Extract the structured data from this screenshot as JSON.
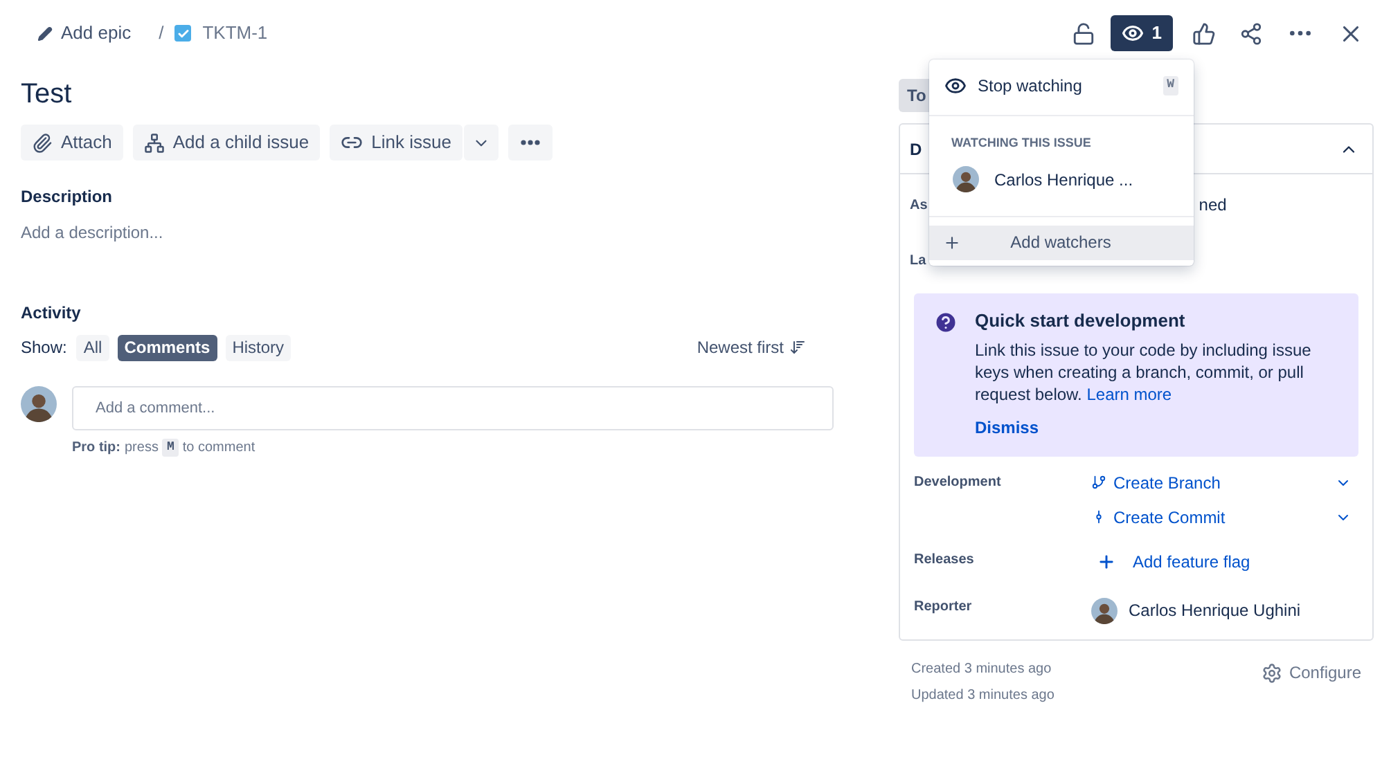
{
  "breadcrumb": {
    "epic": "Add epic",
    "separator": "/",
    "issue_key": "TKTM-1"
  },
  "header_actions": {
    "watch_count": "1",
    "watching": true
  },
  "title": "Test",
  "toolbar": {
    "attach": "Attach",
    "add_child": "Add a child issue",
    "link": "Link issue"
  },
  "description": {
    "heading": "Description",
    "placeholder": "Add a description..."
  },
  "activity": {
    "heading": "Activity",
    "show_label": "Show:",
    "filters": [
      {
        "label": "All",
        "selected": false
      },
      {
        "label": "Comments",
        "selected": true
      },
      {
        "label": "History",
        "selected": false
      }
    ],
    "sort": "Newest first",
    "comment_placeholder": "Add a comment...",
    "tip_bold": "Pro tip:",
    "tip_press": "press",
    "tip_key": "M",
    "tip_rest": "to comment"
  },
  "watch_menu": {
    "stop": "Stop watching",
    "shortcut": "W",
    "section": "WATCHING THIS ISSUE",
    "watchers": [
      "Carlos Henrique ..."
    ],
    "add": "Add watchers"
  },
  "details": {
    "status_partial": "To",
    "header_partial": "D",
    "assignee_label_partial": "As",
    "assignee_value_partial": "ned",
    "labels_label_partial": "La"
  },
  "quick_start": {
    "title": "Quick start development",
    "text": "Link this issue to your code by including issue keys when creating a branch, commit, or pull request below.",
    "link": "Learn more",
    "dismiss": "Dismiss"
  },
  "fields": [
    {
      "kind": "dev",
      "label": "Development",
      "actions": [
        "Create Branch",
        "Create Commit"
      ]
    },
    {
      "kind": "releases",
      "label": "Releases",
      "value": "Add feature flag"
    },
    {
      "kind": "person",
      "label": "Reporter",
      "value": "Carlos Henrique Ughini"
    }
  ],
  "footer": {
    "created": "Created 3 minutes ago",
    "updated": "Updated 3 minutes ago",
    "configure": "Configure"
  }
}
